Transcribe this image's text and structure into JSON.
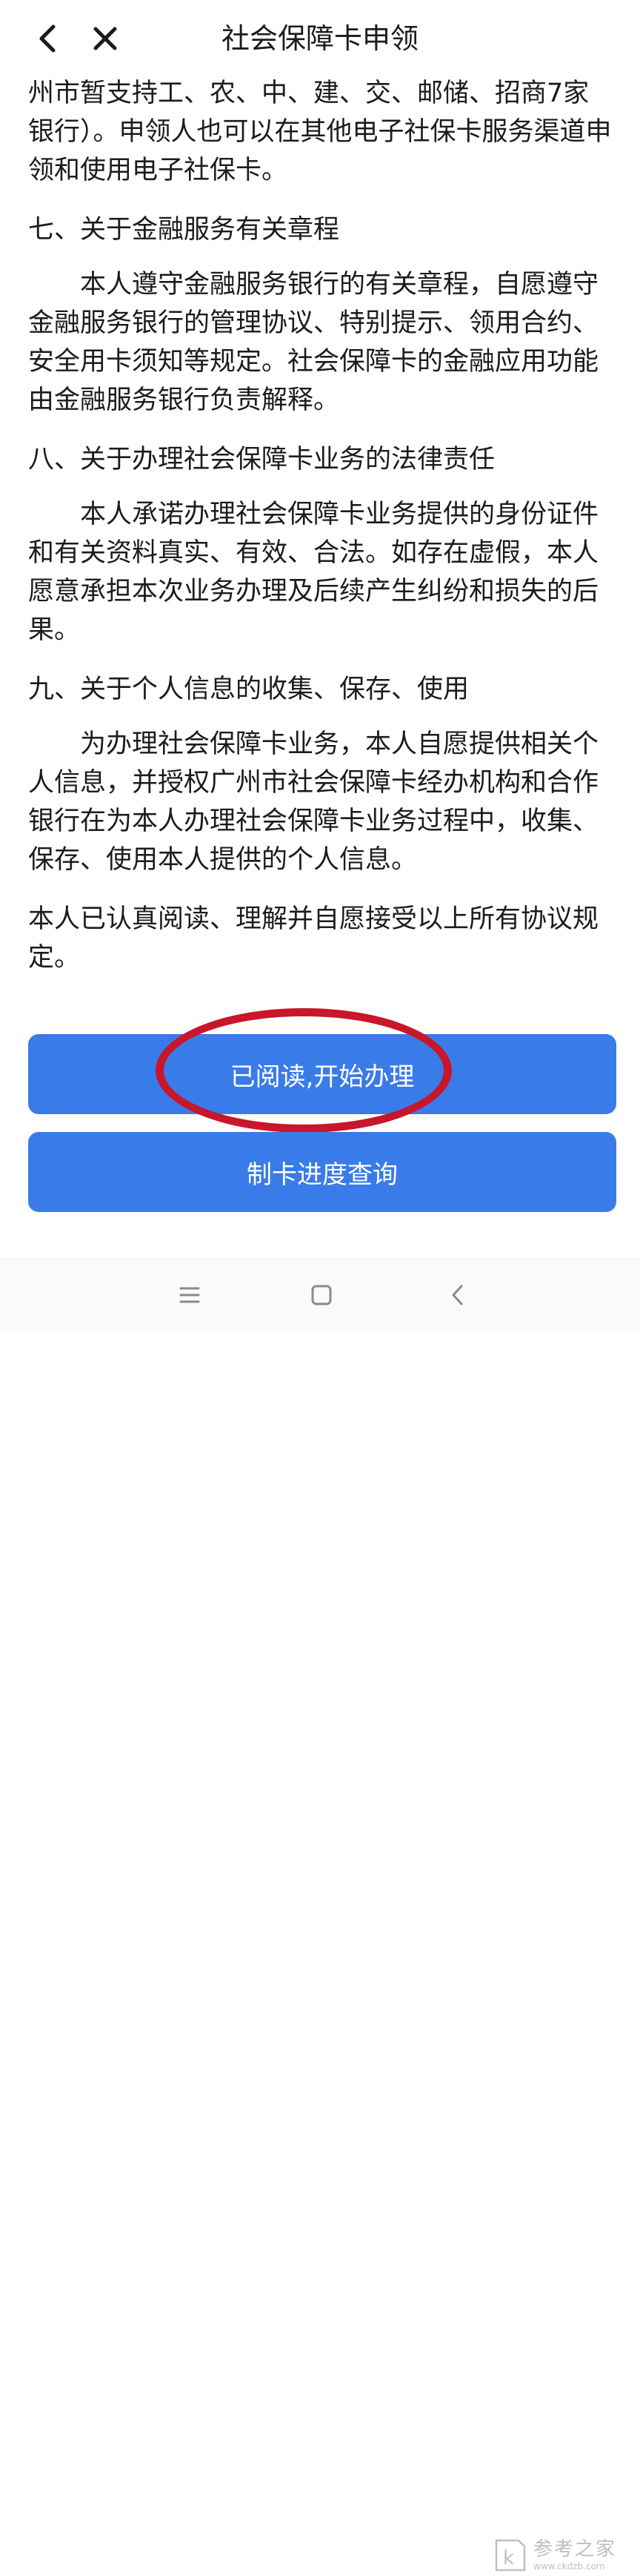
{
  "header": {
    "title": "社会保障卡申领"
  },
  "content": {
    "intro_continuation": "州市暂支持工、农、中、建、交、邮储、招商7家银行）。申领人也可以在其他电子社保卡服务渠道申领和使用电子社保卡。",
    "sections": [
      {
        "heading": "七、关于金融服务有关章程",
        "body": "本人遵守金融服务银行的有关章程，自愿遵守金融服务银行的管理协议、特别提示、领用合约、安全用卡须知等规定。社会保障卡的金融应用功能由金融服务银行负责解释。"
      },
      {
        "heading": "八、关于办理社会保障卡业务的法律责任",
        "body": "本人承诺办理社会保障卡业务提供的身份证件和有关资料真实、有效、合法。如存在虚假，本人愿意承担本次业务办理及后续产生纠纷和损失的后果。"
      },
      {
        "heading": "九、关于个人信息的收集、保存、使用",
        "body": "为办理社会保障卡业务，本人自愿提供相关个人信息，并授权广州市社会保障卡经办机构和合作银行在为本人办理社会保障卡业务过程中，收集、保存、使用本人提供的个人信息。"
      }
    ],
    "closing": "本人已认真阅读、理解并自愿接受以上所有协议规定。"
  },
  "buttons": {
    "start_label": "已阅读,开始办理",
    "progress_label": "制卡进度查询"
  },
  "watermark": {
    "name": "参考之家",
    "url": "www.ckdzb.com",
    "glyph": "k"
  },
  "colors": {
    "button_bg": "#3a7bea",
    "highlight_ring": "#c8162a"
  },
  "icons": {
    "back": "chevron-left-icon",
    "close": "close-icon",
    "nav_menu": "menu-icon",
    "nav_home": "square-icon",
    "nav_back": "chevron-left-icon"
  }
}
